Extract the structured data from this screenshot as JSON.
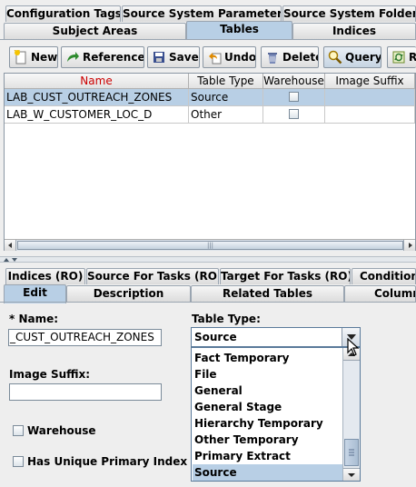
{
  "top_tabs_row1": [
    {
      "label": "Configuration Tags"
    },
    {
      "label": "Source System Parameters"
    },
    {
      "label": "Source System Folders"
    }
  ],
  "top_tabs_row2": [
    {
      "label": "Subject Areas"
    },
    {
      "label": "Tables"
    },
    {
      "label": "Indices"
    }
  ],
  "toolbar": {
    "new": "New",
    "reference": "Reference",
    "save": "Save",
    "undo": "Undo",
    "delete": "Delete",
    "query": "Query",
    "refresh": "R"
  },
  "table": {
    "columns": [
      "Name",
      "Table Type",
      "Warehouse",
      "Image Suffix"
    ],
    "rows": [
      {
        "name": "LAB_CUST_OUTREACH_ZONES",
        "type": "Source",
        "warehouse": false,
        "suffix": ""
      },
      {
        "name": "LAB_W_CUSTOMER_LOC_D",
        "type": "Other",
        "warehouse": false,
        "suffix": ""
      }
    ]
  },
  "scrollbar_grip": "|||",
  "bottom_tabs_row1": [
    {
      "label": "Indices (RO)"
    },
    {
      "label": "Source For Tasks (RO)"
    },
    {
      "label": "Target For Tasks (RO)"
    },
    {
      "label": "Conditional"
    }
  ],
  "bottom_tabs_row2": [
    {
      "label": "Edit"
    },
    {
      "label": "Description"
    },
    {
      "label": "Related Tables"
    },
    {
      "label": "Columns"
    }
  ],
  "form": {
    "name_label": "* Name:",
    "name_value": "_CUST_OUTREACH_ZONES",
    "image_suffix_label": "Image Suffix:",
    "image_suffix_value": "",
    "warehouse_label": "Warehouse",
    "unique_pk_label": "Has Unique Primary Index",
    "table_type_label": "Table Type:",
    "table_type_value": "Source",
    "table_type_options": [
      "Fact Temporary",
      "File",
      "General",
      "General Stage",
      "Hierarchy Temporary",
      "Other Temporary",
      "Primary Extract",
      "Source"
    ]
  },
  "colors": {
    "selection": "#b8cfe5",
    "accent_red": "#cc0000"
  }
}
